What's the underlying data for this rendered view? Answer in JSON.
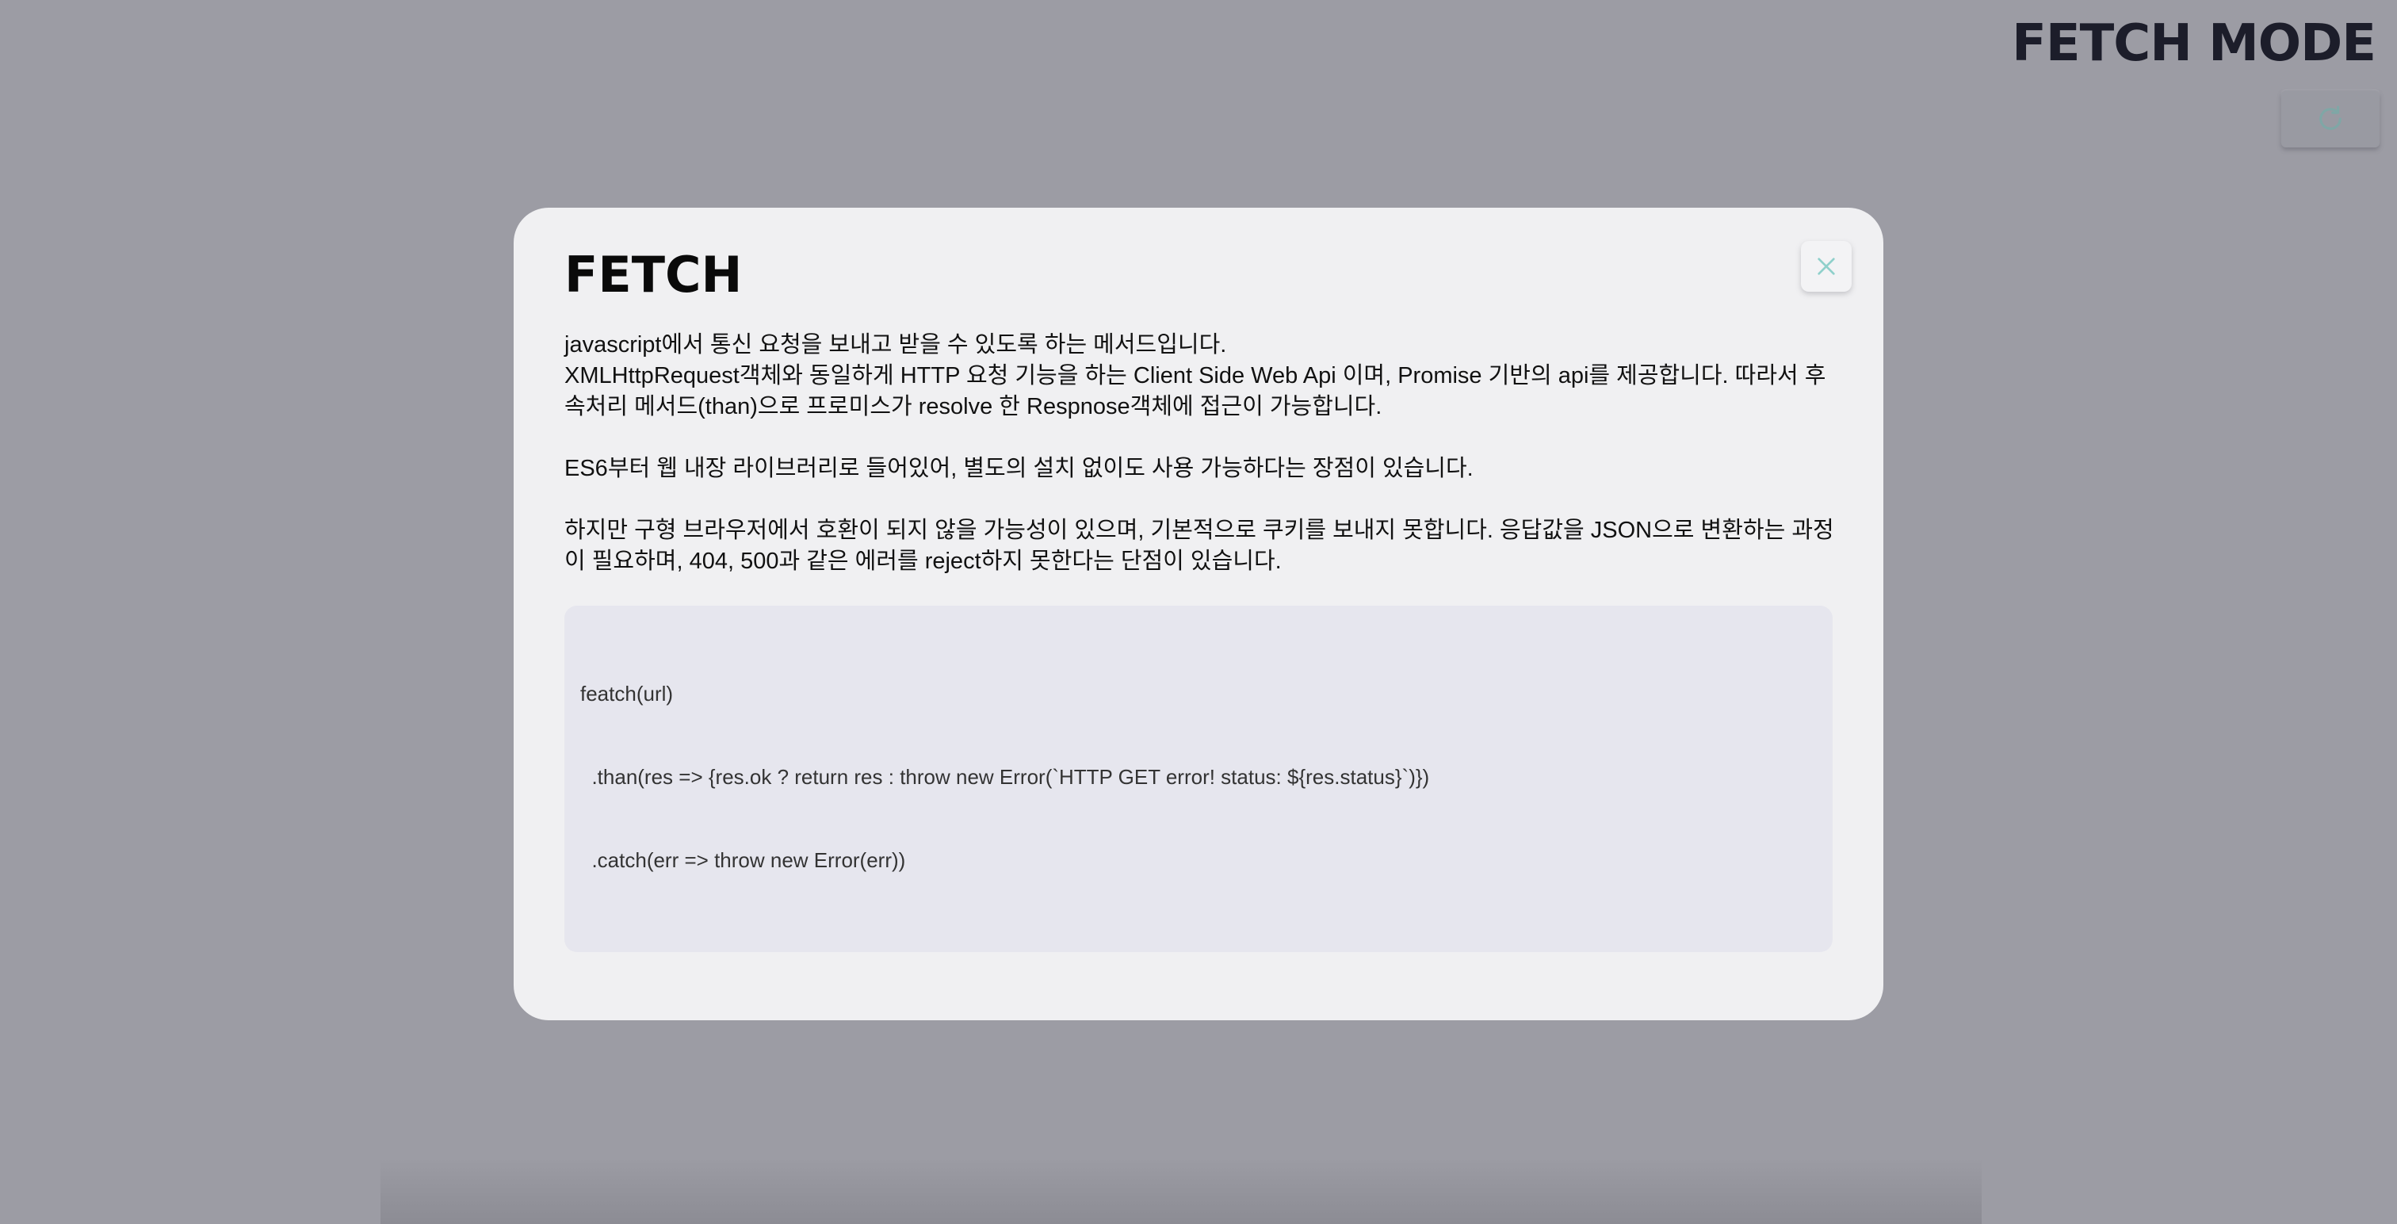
{
  "header": {
    "mode_title": "FETCH MODE",
    "reload_icon": "reload-icon"
  },
  "modal": {
    "title": "FETCH",
    "close_icon": "close-icon",
    "paragraphs": {
      "p1_line1": "javascript에서 통신 요청을 보내고 받을 수 있도록 하는 메서드입니다.",
      "p1_line2": "XMLHttpRequest객체와 동일하게 HTTP 요청 기능을 하는 Client Side Web Api 이며, Promise 기반의 api를 제공합니다. 따라서 후속처리 메서드(than)으로 프로미스가 resolve 한 Respnose객체에 접근이 가능합니다.",
      "p2": "ES6부터 웹 내장 라이브러리로 들어있어, 별도의 설치 없이도 사용 가능하다는 장점이 있습니다.",
      "p3": "하지만 구형 브라우저에서 호환이 되지 않을 가능성이 있으며, 기본적으로 쿠키를 보내지 못합니다. 응답값을 JSON으로 변환하는 과정이 필요하며, 404, 500과 같은 에러를 reject하지 못한다는 단점이 있습니다."
    },
    "code": {
      "line1": "featch(url)",
      "line2": "  .than(res => {res.ok ? return res : throw new Error(`HTTP GET error! status: ${res.status}`)})",
      "line3": "  .catch(err => throw new Error(err))"
    }
  },
  "colors": {
    "backdrop": "#9c9ca4",
    "modal_bg": "#f0f0f2",
    "code_bg": "#e6e6ee",
    "accent_teal": "#8fd0cb",
    "title_dark": "#1c1d2a"
  }
}
